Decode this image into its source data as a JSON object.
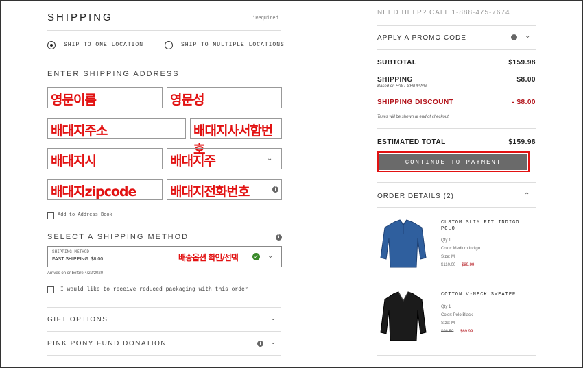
{
  "shipping": {
    "title": "SHIPPING",
    "required": "*Required",
    "ship_one": "SHIP TO ONE LOCATION",
    "ship_multi": "SHIP TO MULTIPLE LOCATIONS",
    "enter_address": "ENTER SHIPPING ADDRESS",
    "fields": {
      "first_name": "영문이름",
      "last_name": "영문성",
      "address": "배대지주소",
      "suite": "배대지사서함번호",
      "city": "배대지시",
      "state": "배대지주",
      "zip": "배대지zipcode",
      "phone": "배대지전화번호"
    },
    "add_address_book": "Add to Address Book",
    "select_method": "SELECT A SHIPPING METHOD",
    "method_label": "SHIPPING METHOD",
    "method_value": "FAST SHIPPING: $8.00",
    "method_annotation": "배송옵션 확인/선택",
    "arrives": "Arrives on or before 4/22/2020",
    "reduced_packaging": "I would like to receive reduced packaging with this order",
    "gift_options": "GIFT OPTIONS",
    "pink_pony": "PINK PONY FUND DONATION"
  },
  "summary": {
    "help": "NEED HELP? CALL 1-888-475-7674",
    "promo": "APPLY A PROMO CODE",
    "subtotal_label": "SUBTOTAL",
    "subtotal_value": "$159.98",
    "shipping_label": "SHIPPING",
    "shipping_sub": "Based on FAST SHIPPING",
    "shipping_value": "$8.00",
    "discount_label": "SHIPPING DISCOUNT",
    "discount_value": "- $8.00",
    "taxes_note": "Taxes will be shown at end of checkout",
    "total_label": "ESTIMATED TOTAL",
    "total_value": "$159.98",
    "continue": "CONTINUE TO PAYMENT",
    "order_details": "ORDER DETAILS (2)"
  },
  "products": [
    {
      "name": "CUSTOM SLIM FIT INDIGO POLO",
      "qty": "Qty 1",
      "color": "Color: Medium Indigo",
      "size": "Size: M",
      "old_price": "$110.00",
      "price": "$89.99"
    },
    {
      "name": "COTTON V-NECK SWEATER",
      "qty": "Qty 1",
      "color": "Color: Polo Black",
      "size": "Size: M",
      "old_price": "$98.50",
      "price": "$69.99"
    }
  ],
  "colors": {
    "accent_red": "#b3141b",
    "annotation_red": "#e21212",
    "button_gray": "#6a6a6a"
  }
}
